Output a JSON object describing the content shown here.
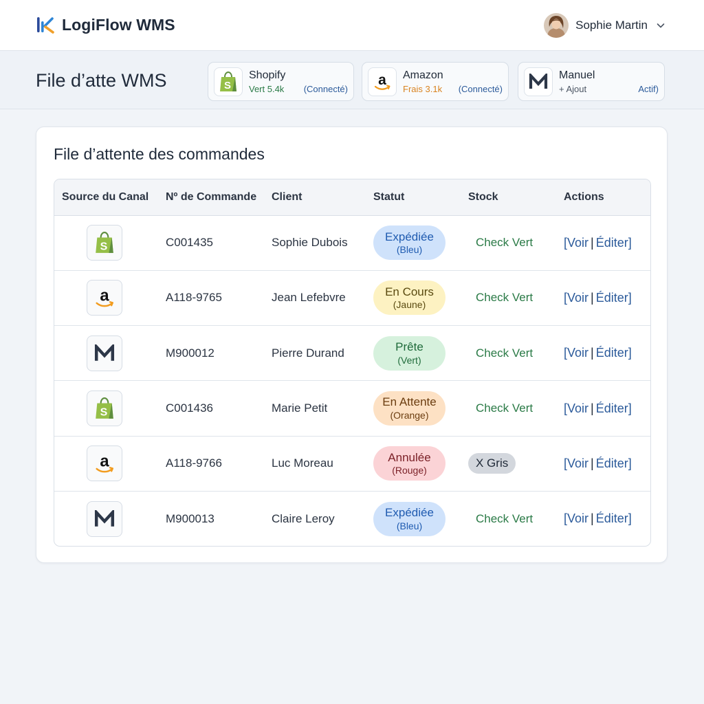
{
  "app": {
    "name": "LogiFlow WMS",
    "user_name": "Sophie Martin"
  },
  "header": {
    "title": "File d’atte WMS",
    "channels": [
      {
        "name": "Shopify",
        "meta1": "Vert 5.4k",
        "meta2": "(Connecté)",
        "meta1_color": "#2a7a46",
        "icon": "shopify-icon"
      },
      {
        "name": "Amazon",
        "meta1": "Frais 3.1k",
        "meta2": "(Connecté)",
        "meta1_color": "#d98320",
        "icon": "amazon-icon"
      },
      {
        "name": "Manuel",
        "meta1": "+ Ajout",
        "meta2": "Actif)",
        "meta1_color": "#4b5563",
        "icon": "manual-m-icon"
      }
    ]
  },
  "orders": {
    "title": "File d’attente des commandes",
    "columns": [
      "Source du Canal",
      "Nº de Commande",
      "Client",
      "Statut",
      "Stock",
      "Actions"
    ],
    "actions": {
      "view": "[Voir",
      "separator": "|",
      "edit": "Éditer]"
    },
    "rows": [
      {
        "source": "shopify",
        "order": "C001435",
        "client": "Sophie Dubois",
        "status": "Expédiée",
        "status_note": "(Bleu)",
        "status_color": "#cfe2fb",
        "status_text": "#1f5bb0",
        "stock": "Check Vert",
        "stock_kind": "ok"
      },
      {
        "source": "amazon",
        "order": "A118-9765",
        "client": "Jean Lefebvre",
        "status": "En Cours",
        "status_note": "(Jaune)",
        "status_color": "#fdf2c2",
        "status_text": "#5a4a10",
        "stock": "Check Vert",
        "stock_kind": "ok"
      },
      {
        "source": "manual",
        "order": "M900012",
        "client": "Pierre Durand",
        "status": "Prête",
        "status_note": "(Vert)",
        "status_color": "#d6f1dd",
        "status_text": "#1f6b3a",
        "stock": "Check Vert",
        "stock_kind": "ok"
      },
      {
        "source": "shopify",
        "order": "C001436",
        "client": "Marie Petit",
        "status": "En Attente",
        "status_note": "(Orange)",
        "status_color": "#fde1c4",
        "status_text": "#6b3d10",
        "stock": "Check Vert",
        "stock_kind": "ok"
      },
      {
        "source": "amazon",
        "order": "A118-9766",
        "client": "Luc Moreau",
        "status": "Annulée",
        "status_note": "(Rouge)",
        "status_color": "#fbd3d6",
        "status_text": "#7a1f26",
        "stock": "X Gris",
        "stock_kind": "none"
      },
      {
        "source": "manual",
        "order": "M900013",
        "client": "Claire Leroy",
        "status": "Expédiée",
        "status_note": "(Bleu)",
        "status_color": "#cfe2fb",
        "status_text": "#1f5bb0",
        "stock": "Check Vert",
        "stock_kind": "ok"
      }
    ]
  }
}
